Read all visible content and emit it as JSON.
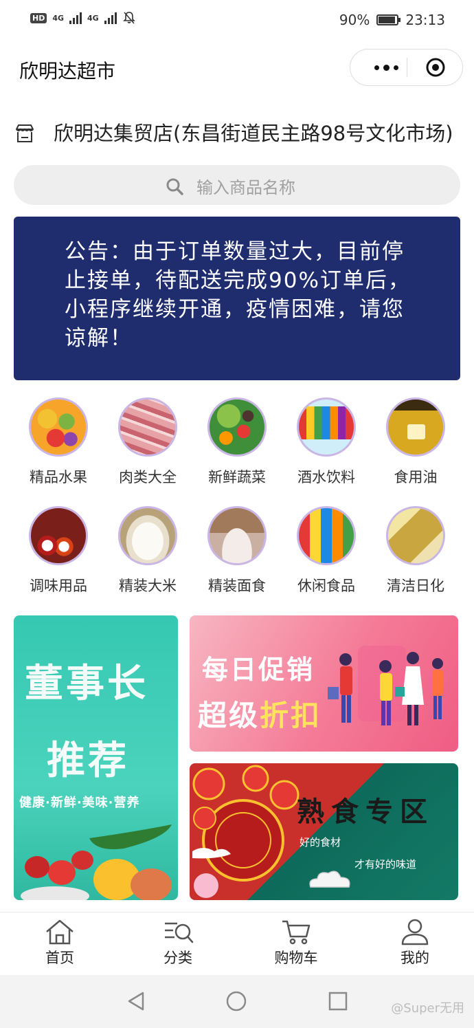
{
  "status_bar": {
    "network_badge": "HD",
    "network_1": "4G",
    "network_2": "4G",
    "battery_percent": "90%",
    "battery_level": 0.9,
    "time": "23:13"
  },
  "header": {
    "title": "欣明达超市",
    "more_icon": "more-dots-icon",
    "close_icon": "target-close-icon"
  },
  "store": {
    "icon": "store-icon",
    "name": "欣明达集贸店(东昌街道民主路98号文化市场)"
  },
  "search": {
    "placeholder": "输入商品名称"
  },
  "announcement": {
    "text": "公告：由于订单数量过大，目前停止接单，待配送完成90%订单后，小程序继续开通，疫情困难，请您谅解！"
  },
  "categories": [
    {
      "label": "精品水果",
      "icon": "fruit-icon",
      "color": "#e9a63a"
    },
    {
      "label": "肉类大全",
      "icon": "meat-icon",
      "color": "#d97b84"
    },
    {
      "label": "新鲜蔬菜",
      "icon": "vegetable-icon",
      "color": "#4f9a3a"
    },
    {
      "label": "酒水饮料",
      "icon": "drinks-icon",
      "color": "#3aa0d9"
    },
    {
      "label": "食用油",
      "icon": "oil-icon",
      "color": "#c9a02a"
    },
    {
      "label": "调味用品",
      "icon": "spice-icon",
      "color": "#b2312b"
    },
    {
      "label": "精装大米",
      "icon": "rice-icon",
      "color": "#c9b38a"
    },
    {
      "label": "精装面食",
      "icon": "flour-icon",
      "color": "#b59a86"
    },
    {
      "label": "休闲食品",
      "icon": "snacks-icon",
      "color": "#d9802a"
    },
    {
      "label": "清洁日化",
      "icon": "detergent-icon",
      "color": "#d9c36a"
    }
  ],
  "banners": {
    "chairman": {
      "line1": "董事长",
      "line2": "推荐",
      "line3": "健康·新鲜·美味·营养"
    },
    "promo": {
      "line1": "每日促销",
      "line2a": "超级",
      "line2b": "折扣"
    },
    "deli": {
      "title": "熟食专区",
      "sub1": "好的食材",
      "sub2": "才有好的味道"
    }
  },
  "tabbar": [
    {
      "label": "首页",
      "icon": "home-icon"
    },
    {
      "label": "分类",
      "icon": "category-search-icon"
    },
    {
      "label": "购物车",
      "icon": "cart-icon"
    },
    {
      "label": "我的",
      "icon": "user-icon"
    }
  ],
  "system_nav": {
    "watermark": "@Super无用"
  }
}
